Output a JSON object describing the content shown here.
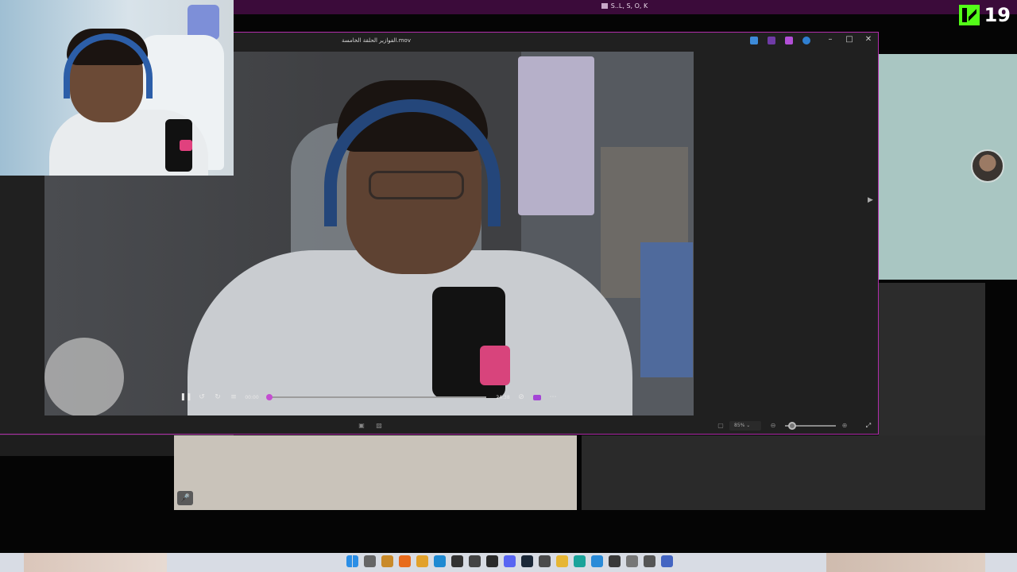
{
  "app": {
    "title": "S..L, S, O, K",
    "viewer_count": "19"
  },
  "player": {
    "file_title": "الفوازير الحلقة الخامسة.mov",
    "current_time": "00:00",
    "total_time": "24:38",
    "progress": 0.0,
    "zoom": "85%",
    "zoom_level": 0.1
  },
  "icons": {
    "play_pause": "pause-icon",
    "rewind": "rewind-10-icon",
    "forward": "forward-30-icon",
    "chapters": "chapters-icon",
    "subtitles": "subtitles-off-icon",
    "cast": "cast-icon",
    "more": "more-icon",
    "mic_off": "mic-off-icon"
  },
  "colors": {
    "accent": "#c44dd1",
    "window_border": "#b12dab",
    "top_bar": "#3b0b3a",
    "kick_green": "#53fc18"
  },
  "taskbar": {
    "apps": [
      "windows-start-icon",
      "search-icon",
      "file-manager-icon",
      "avast-icon",
      "app-icon",
      "vscode-icon",
      "terminal-icon",
      "obs-icon",
      "app-icon",
      "discord-icon",
      "steam-icon",
      "app-icon",
      "explorer-icon",
      "edge-icon",
      "notepad-icon",
      "terminal-icon",
      "settings-icon",
      "app-icon",
      "media-player-icon"
    ]
  }
}
